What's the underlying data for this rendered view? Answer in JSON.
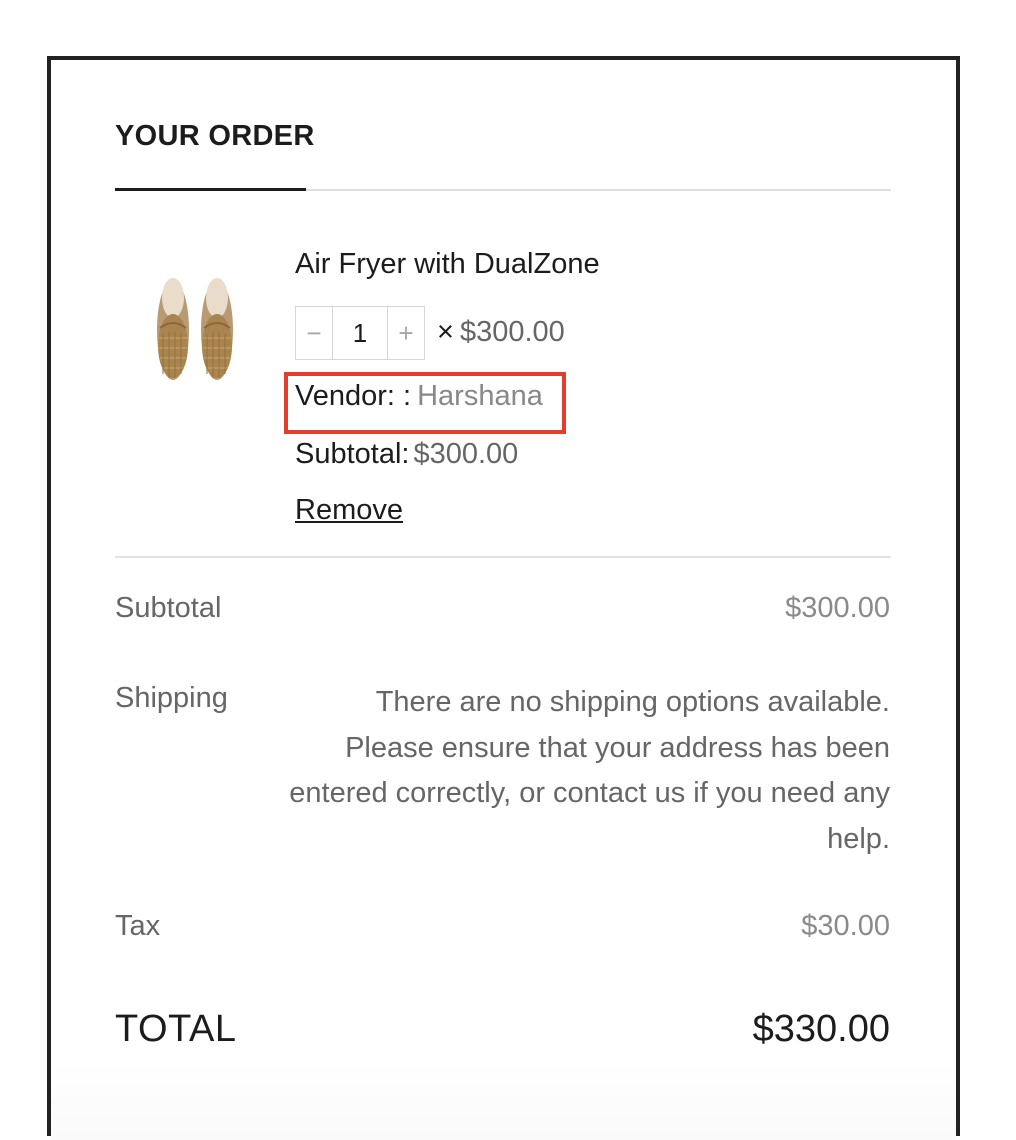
{
  "order": {
    "heading": "YOUR ORDER",
    "item": {
      "name": "Air Fryer with DualZone",
      "image": "tan-loafer-shoes-image",
      "quantity": "1",
      "qty_minus": "−",
      "qty_plus": "+",
      "times_symbol": "×",
      "unit_price": "$300.00",
      "vendor_label": "Vendor: :",
      "vendor_value": "Harshana",
      "subtotal_label": "Subtotal:",
      "subtotal_value": "$300.00",
      "remove_label": "Remove"
    },
    "summary": {
      "subtotal_label": "Subtotal",
      "subtotal_value": "$300.00",
      "shipping_label": "Shipping",
      "shipping_message": "There are no shipping options available. Please ensure that your address has been entered correctly, or contact us if you need any help.",
      "tax_label": "Tax",
      "tax_value": "$30.00",
      "total_label": "TOTAL",
      "total_value": "$330.00"
    }
  },
  "colors": {
    "highlight_box": "#e23e2b",
    "border": "#222222",
    "muted_text": "#666666"
  }
}
